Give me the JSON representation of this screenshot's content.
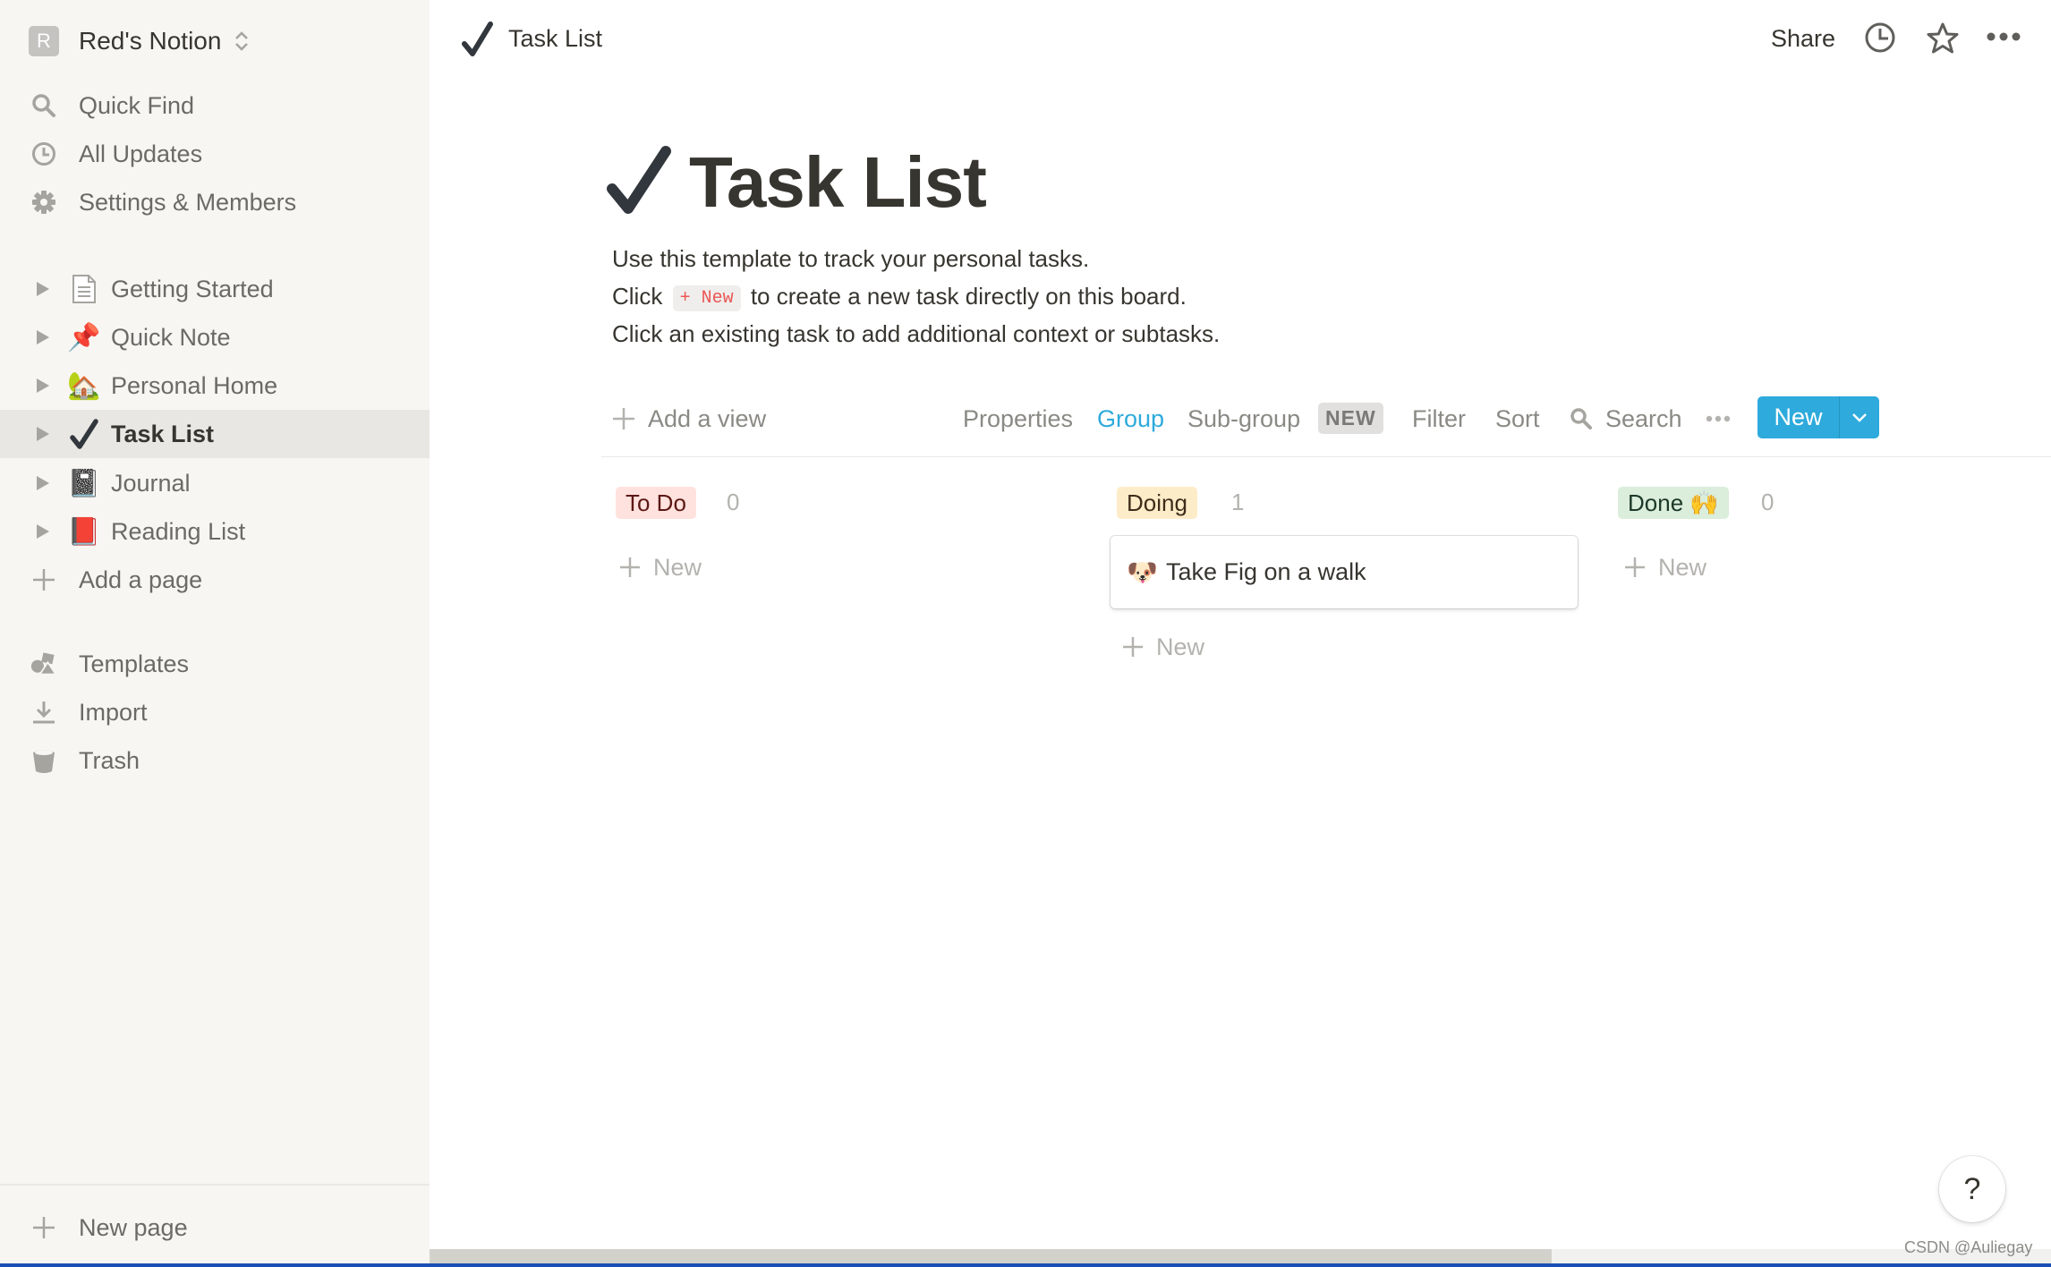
{
  "sidebar": {
    "workspace": {
      "avatar_letter": "R",
      "name": "Red's Notion"
    },
    "nav": [
      {
        "label": "Quick Find",
        "icon": "search-icon"
      },
      {
        "label": "All Updates",
        "icon": "clock-icon"
      },
      {
        "label": "Settings & Members",
        "icon": "gear-icon"
      }
    ],
    "pages": [
      {
        "label": "Getting Started",
        "emoji": "📄",
        "active": false
      },
      {
        "label": "Quick Note",
        "emoji": "📌",
        "active": false
      },
      {
        "label": "Personal Home",
        "emoji": "🏡",
        "active": false
      },
      {
        "label": "Task List",
        "emoji": "✔️",
        "active": true
      },
      {
        "label": "Journal",
        "emoji": "📓",
        "active": false
      },
      {
        "label": "Reading List",
        "emoji": "📕",
        "active": false
      }
    ],
    "add_page_label": "Add a page",
    "bottom": [
      {
        "label": "Templates",
        "icon": "templates-icon"
      },
      {
        "label": "Import",
        "icon": "import-icon"
      },
      {
        "label": "Trash",
        "icon": "trash-icon"
      }
    ],
    "new_page_label": "New page"
  },
  "topbar": {
    "breadcrumb_title": "Task List",
    "share_label": "Share"
  },
  "page": {
    "title": "Task List",
    "description": {
      "line1": "Use this template to track your personal tasks.",
      "line2_before": "Click",
      "line2_code": "+ New",
      "line2_after": "to create a new task directly on this board.",
      "line3": "Click an existing task to add additional context or subtasks."
    }
  },
  "toolbar": {
    "add_view": "Add a view",
    "properties": "Properties",
    "group": "Group",
    "subgroup": "Sub-group",
    "subgroup_badge": "NEW",
    "filter": "Filter",
    "sort": "Sort",
    "search": "Search",
    "new_button": "New",
    "accent_color": "#2eaadc"
  },
  "board": {
    "columns": [
      {
        "label": "To Do",
        "count": "0",
        "bg": "#ffe2dd",
        "fg": "#5d1715",
        "new_label": "New",
        "cards": []
      },
      {
        "label": "Doing",
        "count": "1",
        "bg": "#fdecc8",
        "fg": "#402c1b",
        "new_label": "New",
        "cards": [
          {
            "emoji": "🐶",
            "title": "Take Fig on a walk"
          }
        ]
      },
      {
        "label": "Done 🙌",
        "count": "0",
        "bg": "#dbeddb",
        "fg": "#1c3829",
        "new_label": "New",
        "cards": []
      }
    ]
  },
  "help_label": "?",
  "watermark": "CSDN @Auliegay"
}
